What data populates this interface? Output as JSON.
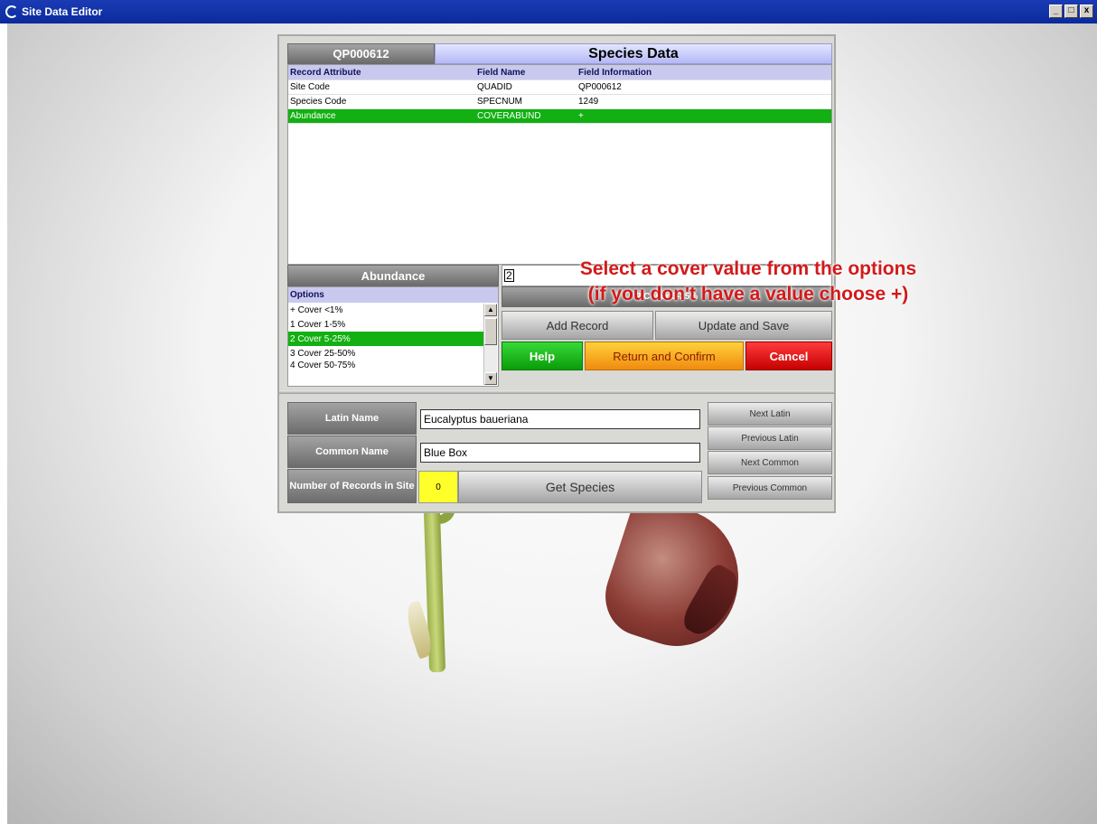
{
  "window": {
    "title": "Site Data Editor",
    "min": "_",
    "max": "□",
    "close": "x"
  },
  "dialog": {
    "site_code_tab": "QP000612",
    "species_header": "Species Data",
    "table": {
      "headers": [
        "Record Attribute",
        "Field Name",
        "Field Information"
      ],
      "rows": [
        [
          "Site Code",
          "QUADID",
          "QP000612"
        ],
        [
          "Species Code",
          "SPECNUM",
          "1249"
        ],
        [
          "Abundance",
          "COVERABUND",
          "+"
        ]
      ]
    },
    "abundance_header": "Abundance",
    "options_header": "Options",
    "options": [
      "+  Cover <1%",
      "1  Cover 1-5%",
      "2  Cover 5-25%",
      "3  Cover 25-50%",
      "4  Cover 50-75%"
    ],
    "value_input": "2",
    "selected_display": "2  Cover 5-25%",
    "buttons": {
      "add_record": "Add Record",
      "update_save": "Update and Save",
      "help": "Help",
      "return_confirm": "Return and Confirm",
      "cancel": "Cancel",
      "get_species": "Get Species",
      "next_latin": "Next Latin",
      "previous_latin": "Previous Latin",
      "next_common": "Next Common",
      "previous_common": "Previous Common"
    },
    "labels": {
      "latin_name": "Latin Name",
      "common_name": "Common Name",
      "number_of_records": "Number of Records in Site"
    },
    "latin_name_value": "Eucalyptus baueriana",
    "common_name_value": "Blue Box",
    "record_count": "0"
  },
  "annotation": {
    "line1": "Select a cover value from the options",
    "line2": "(if you don't have a value choose +)"
  },
  "colors": {
    "selection": "#12b012",
    "annotation": "#d21a1a",
    "titlebar": "#0a2a9c"
  }
}
